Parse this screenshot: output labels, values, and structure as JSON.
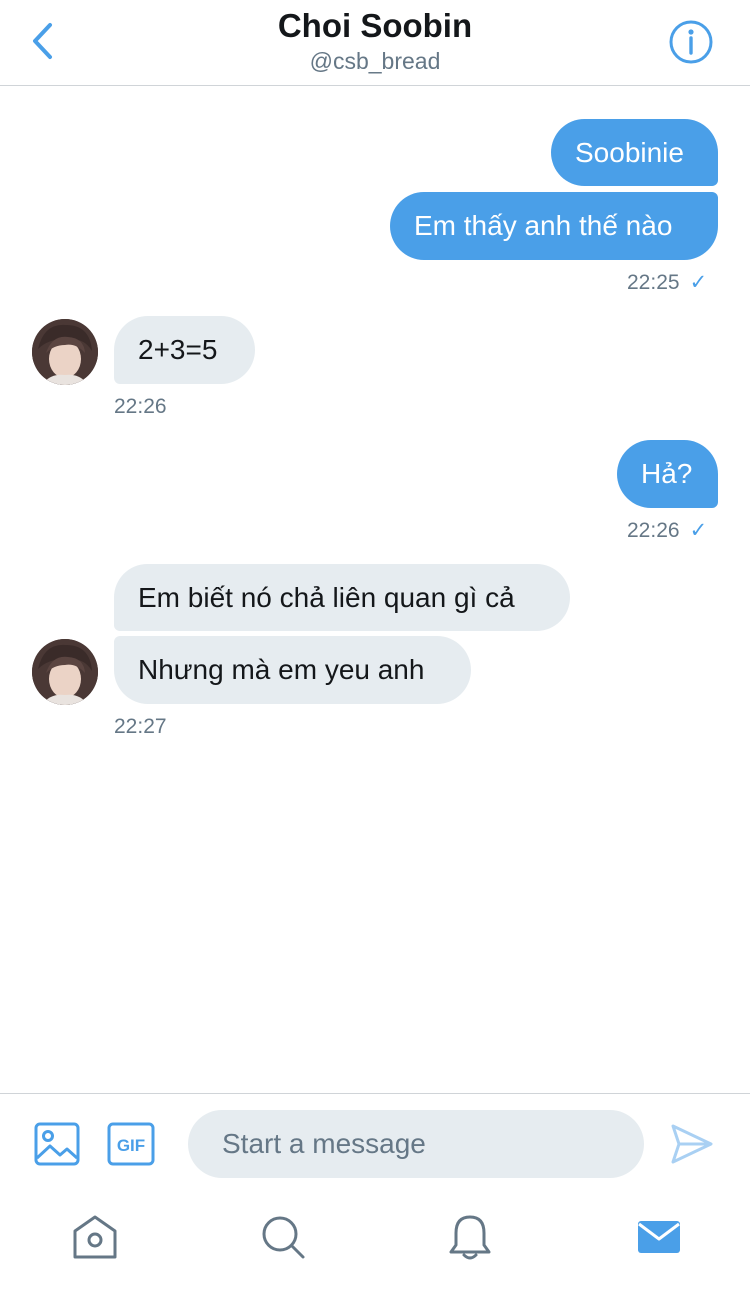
{
  "header": {
    "title": "Choi Soobin",
    "handle": "@csb_bread"
  },
  "messages": [
    {
      "direction": "outgoing",
      "text": "Soobinie"
    },
    {
      "direction": "outgoing",
      "text": "Em thấy anh thế nào"
    },
    {
      "direction": "outgoing",
      "time": "22:25",
      "check": "✓"
    },
    {
      "direction": "incoming",
      "text": "2+3=5"
    },
    {
      "direction": "incoming",
      "time": "22:26"
    },
    {
      "direction": "outgoing",
      "text": "Hả?"
    },
    {
      "direction": "outgoing",
      "time": "22:26",
      "check": "✓"
    },
    {
      "direction": "incoming",
      "text": "Em biết nó chả liên quan gì cả"
    },
    {
      "direction": "incoming",
      "text": "Nhưng mà em yeu anh"
    },
    {
      "direction": "incoming",
      "time": "22:27"
    }
  ],
  "composer": {
    "placeholder": "Start a message",
    "gif_label": "GIF"
  },
  "tabs": [
    "home-icon",
    "search-icon",
    "notifications-icon",
    "messages-icon"
  ],
  "colors": {
    "accent": "#4a9fe8",
    "incoming_bubble": "#e6ecf0",
    "muted_text": "#657786"
  }
}
